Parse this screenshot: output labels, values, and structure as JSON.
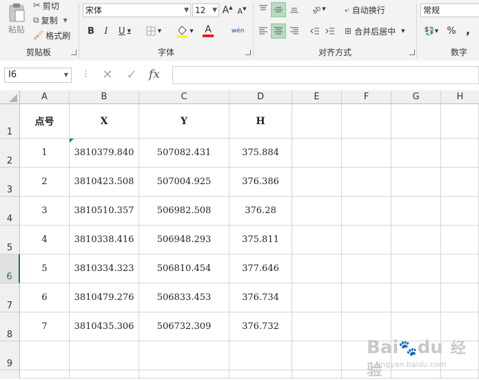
{
  "ribbon": {
    "clipboard": {
      "paste_label": "粘贴",
      "cut_label": "剪切",
      "copy_label": "复制",
      "format_painter_label": "格式刷",
      "group_label": "剪贴板"
    },
    "font": {
      "font_name": "宋体",
      "font_size": "12",
      "grow_label": "A",
      "shrink_label": "A",
      "bold_label": "B",
      "italic_label": "I",
      "underline_label": "U",
      "font_color_label": "A",
      "phonetic_label": "wén",
      "group_label": "字体"
    },
    "alignment": {
      "wrap_text_label": "自动换行",
      "merge_center_label": "合并后居中",
      "group_label": "对齐方式"
    },
    "number": {
      "format": "常规",
      "percent_label": "%",
      "comma_label": ",",
      "group_label": "数字"
    }
  },
  "formula_bar": {
    "name_box": "I6",
    "fx_label": "fx",
    "formula": ""
  },
  "sheet": {
    "columns": [
      "A",
      "B",
      "C",
      "D",
      "E",
      "F",
      "G",
      "H"
    ],
    "rows": [
      "1",
      "2",
      "3",
      "4",
      "5",
      "6",
      "7",
      "8",
      "9"
    ],
    "header": [
      "点号",
      "X",
      "Y",
      "H"
    ],
    "data": [
      [
        "1",
        "3810379.840",
        "507082.431",
        "375.884"
      ],
      [
        "2",
        "3810423.508",
        "507004.925",
        "376.386"
      ],
      [
        "3",
        "3810510.357",
        "506982.508",
        "376.28"
      ],
      [
        "4",
        "3810338.416",
        "506948.293",
        "375.811"
      ],
      [
        "5",
        "3810334.323",
        "506810.454",
        "377.646"
      ],
      [
        "6",
        "3810479.276",
        "506833.453",
        "376.734"
      ],
      [
        "7",
        "3810435.306",
        "506732.309",
        "376.732"
      ]
    ],
    "selected_row": "6"
  },
  "watermark": {
    "brand": "Bai",
    "brand2": "du",
    "site": "经验",
    "url": "jingyan.baidu.com"
  },
  "colors": {
    "accent": "#217346",
    "ribbon_bg": "#f3f3f3",
    "pressed": "#b7dcc0",
    "highlight_yellow": "#ffff00",
    "font_red": "#e8201c"
  }
}
